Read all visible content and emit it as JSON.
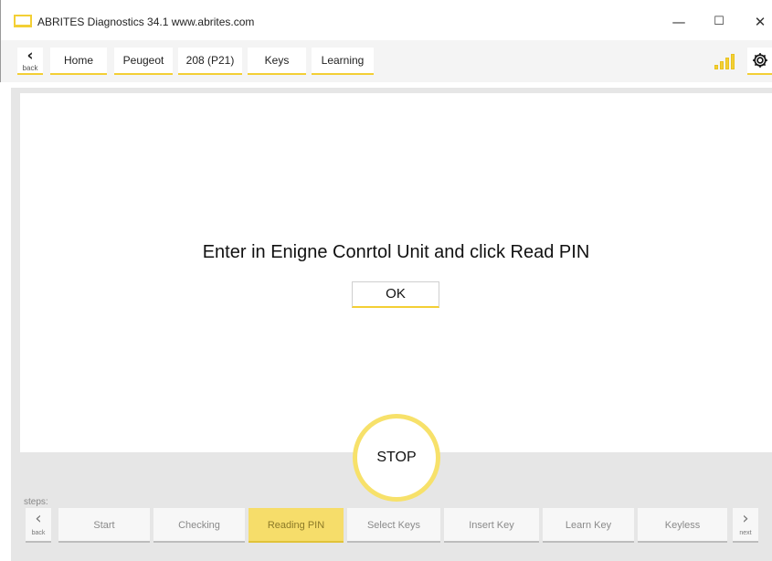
{
  "window": {
    "title": "ABRITES Diagnostics 34.1   www.abrites.com",
    "minimize_glyph": "—",
    "maximize_glyph": "☐",
    "close_glyph": "✕"
  },
  "nav": {
    "back_label": "back",
    "breadcrumbs": [
      "Home",
      "Peugeot",
      "208 (P21)",
      "Keys",
      "Learning"
    ],
    "icons": [
      "signal-strength-icon",
      "gear-icon"
    ]
  },
  "dialog": {
    "message": "Enter in Enigne Conrtol Unit and click Read PIN",
    "ok_label": "OK"
  },
  "stop_label": "STOP",
  "steps": {
    "label": "steps:",
    "back_label": "back",
    "next_label": "next",
    "items": [
      "Start",
      "Checking",
      "Reading PIN",
      "Select Keys",
      "Insert Key",
      "Learn Key",
      "Keyless"
    ],
    "active": "Reading PIN"
  },
  "colors": {
    "accent": "#f3cf35",
    "active_step": "#f6dd6a",
    "panel_bg": "#e6e6e6"
  }
}
